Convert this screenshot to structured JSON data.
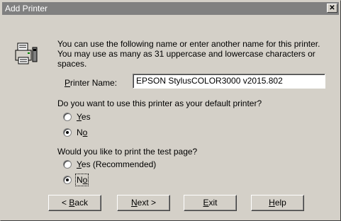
{
  "window": {
    "title": "Add Printer",
    "close_glyph": "✕"
  },
  "description": {
    "lines": [
      "You can use the following name or enter another name for this printer.",
      "You may use as many as 31 uppercase and lowercase characters or",
      "spaces."
    ]
  },
  "printer_name": {
    "label_first": "P",
    "label_rest": "rinter Name:",
    "value": "EPSON StylusCOLOR3000 v2015.802"
  },
  "default_printer": {
    "question": "Do you want to use this printer as your default printer?",
    "yes": {
      "mnemonic": "Y",
      "rest": "es"
    },
    "no": {
      "first": "N",
      "mnemonic": "o"
    },
    "selected": "no"
  },
  "test_page": {
    "question": "Would you like to print the test page?",
    "yes": {
      "mnemonic": "Y",
      "rest": "es (Recommended)"
    },
    "no": {
      "first": "N",
      "mnemonic": "o"
    },
    "selected": "no"
  },
  "buttons": {
    "back": {
      "prefix": "< ",
      "mnemonic": "B",
      "rest": "ack"
    },
    "next": {
      "mnemonic": "N",
      "rest": "ext >"
    },
    "exit": {
      "mnemonic": "E",
      "rest": "xit"
    },
    "help": {
      "mnemonic": "H",
      "rest": "elp"
    }
  }
}
